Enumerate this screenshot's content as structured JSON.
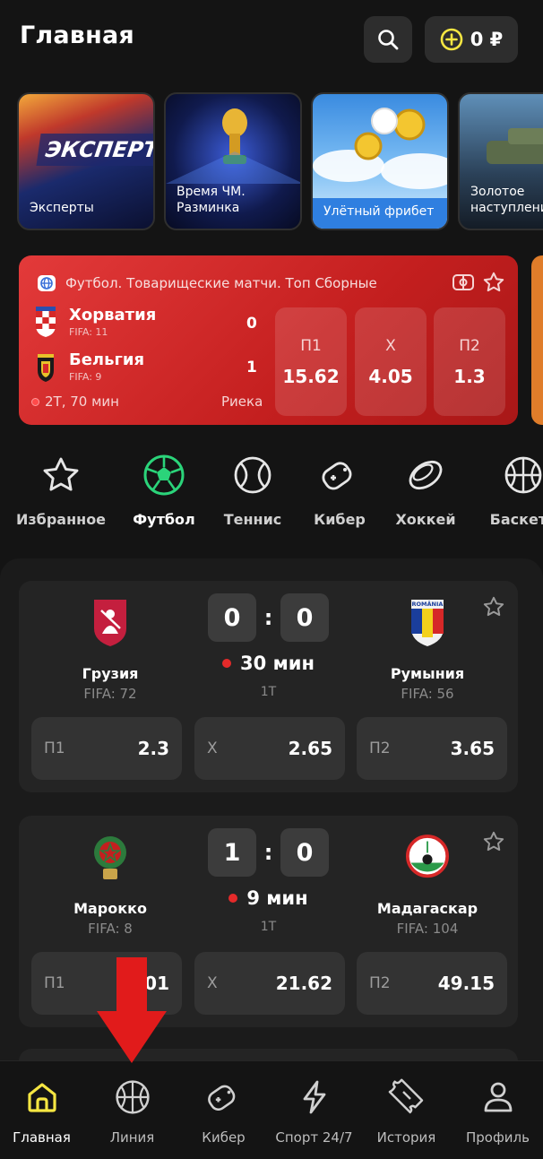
{
  "header": {
    "title": "Главная",
    "balance": "0 ₽"
  },
  "stories": [
    {
      "label": "Эксперты",
      "banner_text": "ЭКСПЕРТЫ"
    },
    {
      "label": "Время ЧМ.\nРазминка"
    },
    {
      "label": "Улётный фрибет"
    },
    {
      "label": "Золотое\nнаступлени"
    }
  ],
  "live_featured": {
    "league": "Футбол. Товарищеские матчи. Топ Сборные",
    "team1": {
      "name": "Хорватия",
      "fifa": "FIFA: 11",
      "score": "0"
    },
    "team2": {
      "name": "Бельгия",
      "fifa": "FIFA: 9",
      "score": "1"
    },
    "time": "2Т, 70 мин",
    "venue": "Риека",
    "odds": [
      {
        "label": "П1",
        "value": "15.62"
      },
      {
        "label": "Х",
        "value": "4.05"
      },
      {
        "label": "П2",
        "value": "1.3"
      }
    ]
  },
  "sports": [
    {
      "label": "Избранное",
      "icon": "star-icon"
    },
    {
      "label": "Футбол",
      "icon": "soccer-ball-icon",
      "active": true
    },
    {
      "label": "Теннис",
      "icon": "tennis-ball-icon"
    },
    {
      "label": "Кибер",
      "icon": "gamepad-icon"
    },
    {
      "label": "Хоккей",
      "icon": "hockey-puck-icon"
    },
    {
      "label": "Баскетб",
      "icon": "basketball-icon"
    }
  ],
  "matches": [
    {
      "team1": {
        "name": "Грузия",
        "fifa": "FIFA: 72"
      },
      "team2": {
        "name": "Румыния",
        "fifa": "FIFA: 56",
        "logo_text": "ROMÂNIA"
      },
      "score1": "0",
      "score2": "0",
      "colon": ":",
      "time": "30 мин",
      "period": "1Т",
      "odds": [
        {
          "label": "П1",
          "value": "2.3"
        },
        {
          "label": "Х",
          "value": "2.65"
        },
        {
          "label": "П2",
          "value": "3.65"
        }
      ]
    },
    {
      "team1": {
        "name": "Марокко",
        "fifa": "FIFA: 8"
      },
      "team2": {
        "name": "Мадагаскар",
        "fifa": "FIFA: 104"
      },
      "score1": "1",
      "score2": "0",
      "colon": ":",
      "time": "9 мин",
      "period": "1Т",
      "odds": [
        {
          "label": "П1",
          "value": "01"
        },
        {
          "label": "Х",
          "value": "21.62"
        },
        {
          "label": "П2",
          "value": "49.15"
        }
      ]
    }
  ],
  "bottom_nav": [
    {
      "label": "Главная",
      "icon": "home-icon",
      "active": true
    },
    {
      "label": "Линия",
      "icon": "basketball-icon"
    },
    {
      "label": "Кибер",
      "icon": "gamepad-icon"
    },
    {
      "label": "Спорт 24/7",
      "icon": "lightning-icon"
    },
    {
      "label": "История",
      "icon": "ticket-icon"
    },
    {
      "label": "Профиль",
      "icon": "user-icon"
    }
  ],
  "colors": {
    "accent_yellow": "#f5e642",
    "accent_green": "#2bd47a",
    "live_red": "#d92b2b",
    "annotation_arrow": "#e11b1b"
  }
}
